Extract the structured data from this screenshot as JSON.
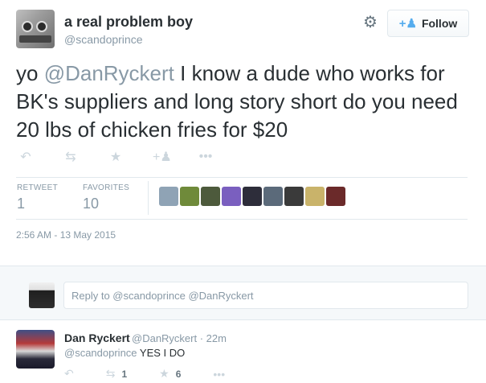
{
  "author": {
    "display_name": "a real problem boy",
    "handle": "@scandoprince"
  },
  "follow_button": {
    "label": "Follow"
  },
  "tweet": {
    "mention": "@DanRyckert",
    "text_before": "yo ",
    "text_after": " I know a dude who works for BK's suppliers and long story short do you need 20 lbs of chicken fries for $20",
    "timestamp": "2:56 AM - 13 May 2015"
  },
  "stats": {
    "retweet_label": "RETWEET",
    "retweet_count": "1",
    "favorites_label": "FAVORITES",
    "favorites_count": "10"
  },
  "icons": {
    "reply": "reply-icon",
    "retweet": "retweet-icon",
    "favorite": "star-icon",
    "follow": "follow-user-icon",
    "more": "more-icon",
    "settings": "gear-icon"
  },
  "favoriter_avatar_colors": [
    "#8fa3b5",
    "#6f8a3a",
    "#4d5a3c",
    "#7a5fbf",
    "#2d2d3a",
    "#5b6a7a",
    "#3a3a3a",
    "#c9b36a",
    "#6b2a2a"
  ],
  "reply_box": {
    "placeholder": "Reply to @scandoprince @DanRyckert"
  },
  "reply_tweet": {
    "display_name": "Dan Ryckert",
    "handle_time": "@DanRyckert · 22m",
    "mention": "@scandoprince",
    "text": " YES I DO",
    "retweet_count": "1",
    "favorite_count": "6"
  },
  "colors": {
    "accent": "#55acee",
    "muted": "#8899a6",
    "text": "#292f33",
    "border": "#e1e8ed"
  }
}
